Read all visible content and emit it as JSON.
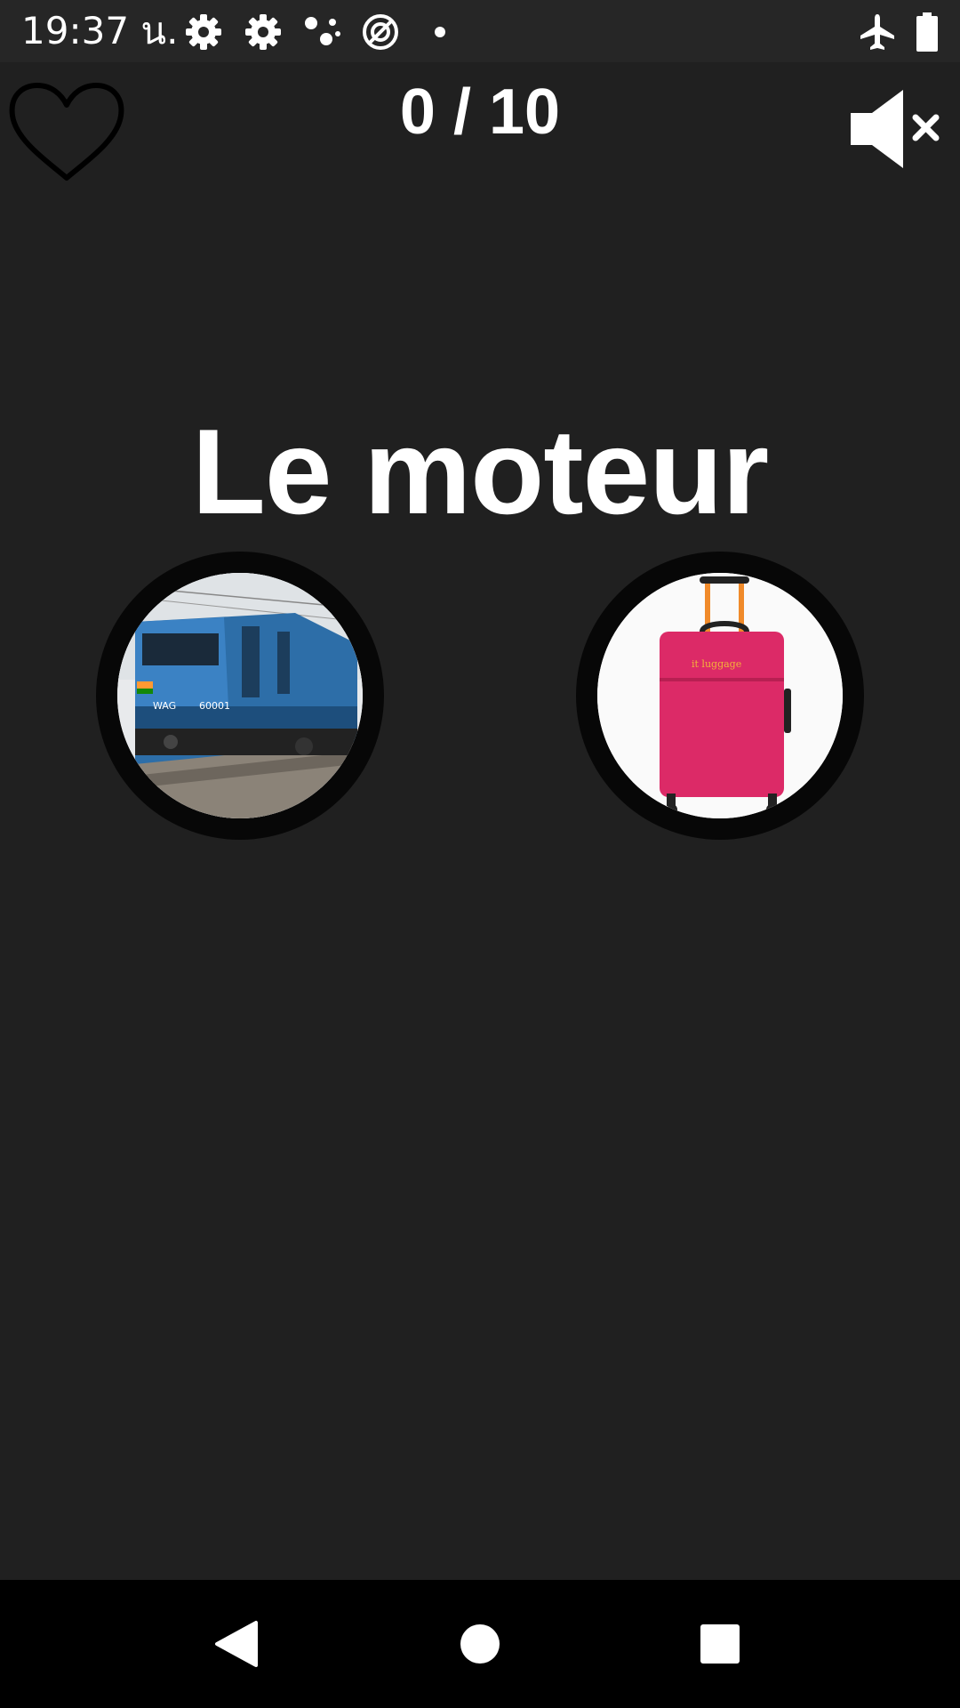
{
  "status_bar": {
    "time": "19:37 น.",
    "icons": [
      "settings-icon",
      "settings-icon",
      "assistant-dots-icon",
      "data-saver-icon",
      "notification-dot-icon",
      "airplane-mode-icon",
      "battery-icon"
    ]
  },
  "header": {
    "progress": "0 / 10",
    "favorite_icon": "heart-outline-icon",
    "sound_icon": "volume-mute-icon"
  },
  "question": {
    "word": "Le moteur"
  },
  "choices": [
    {
      "image": "locomotive-photo"
    },
    {
      "image": "pink-suitcase-photo"
    }
  ],
  "navigation": {
    "buttons": [
      "back-icon",
      "home-icon",
      "recents-icon"
    ]
  },
  "colors": {
    "background": "#202020",
    "status_bar": "#262626",
    "text": "#ffffff",
    "choice_ring": "#070707",
    "nav_bar": "#000000"
  }
}
